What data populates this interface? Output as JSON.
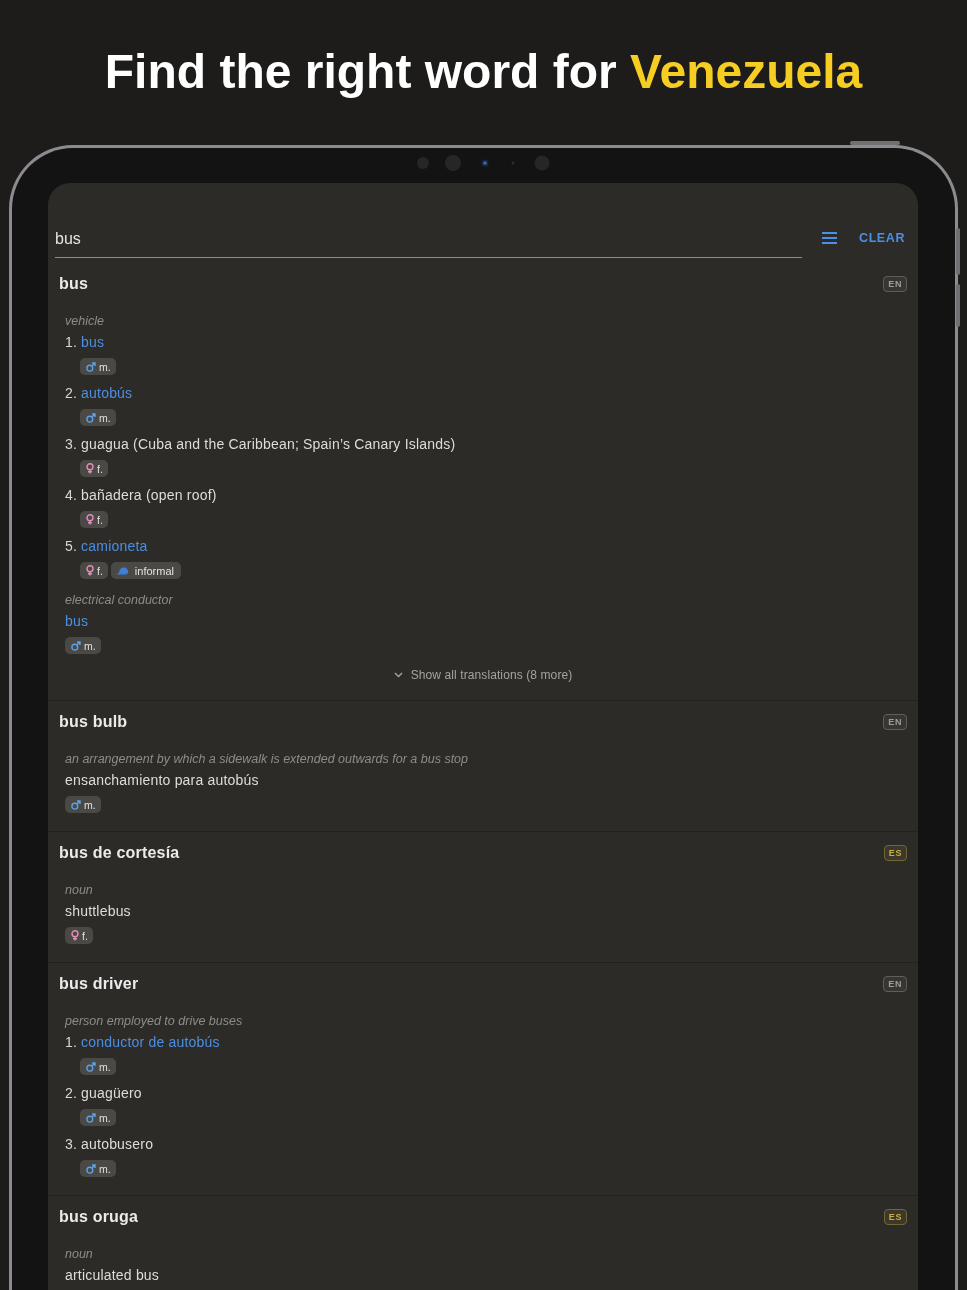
{
  "headline": {
    "text": "Find the right word for",
    "highlight": "Venezuela"
  },
  "search": {
    "value": "bus"
  },
  "clear_button": "CLEAR",
  "entries": [
    {
      "headword": "bus",
      "badge": {
        "text": "EN",
        "color": "#9d9c99"
      },
      "senses": [
        {
          "label": "vehicle",
          "translations": [
            {
              "number": "1.",
              "text": "bus",
              "linked": true,
              "tags": [
                {
                  "kind": "masculine",
                  "text": "m."
                }
              ]
            },
            {
              "number": "2.",
              "text": "autobús",
              "linked": true,
              "tags": [
                {
                  "kind": "masculine",
                  "text": "m."
                }
              ]
            },
            {
              "number": "3.",
              "text": "guagua (Cuba and the Caribbean; Spain’s Canary Islands)",
              "linked": false,
              "tags": [
                {
                  "kind": "feminine",
                  "text": "f."
                }
              ]
            },
            {
              "number": "4.",
              "text": "bañadera (open roof)",
              "linked": false,
              "tags": [
                {
                  "kind": "feminine",
                  "text": "f."
                }
              ]
            },
            {
              "number": "5.",
              "text": "camioneta",
              "linked": true,
              "tags": [
                {
                  "kind": "feminine",
                  "text": "f."
                },
                {
                  "kind": "register",
                  "text": "informal"
                }
              ]
            }
          ]
        },
        {
          "label": "electrical conductor",
          "translations": [
            {
              "text": "bus",
              "linked": true,
              "tags": [
                {
                  "kind": "masculine",
                  "text": "m."
                }
              ]
            }
          ]
        }
      ],
      "show_more": "Show all translations (8 more)"
    },
    {
      "headword": "bus bulb",
      "badge": {
        "text": "EN",
        "color": "#9d9c99"
      },
      "senses": [
        {
          "label": "an arrangement by which a sidewalk is extended outwards for a bus stop",
          "translations": [
            {
              "text": "ensanchamiento para autobús",
              "linked": false,
              "tags": [
                {
                  "kind": "masculine",
                  "text": "m."
                }
              ]
            }
          ]
        }
      ]
    },
    {
      "headword": "bus de cortesía",
      "badge": {
        "text": "ES",
        "color": "#c9ad45"
      },
      "senses": [
        {
          "label": "noun",
          "translations": [
            {
              "text": "shuttlebus",
              "linked": false,
              "tags": [
                {
                  "kind": "feminine",
                  "text": "f."
                }
              ]
            }
          ]
        }
      ]
    },
    {
      "headword": "bus driver",
      "badge": {
        "text": "EN",
        "color": "#9d9c99"
      },
      "senses": [
        {
          "label": "person employed to drive buses",
          "translations": [
            {
              "number": "1.",
              "text": "conductor de autobús",
              "linked": true,
              "tags": [
                {
                  "kind": "masculine",
                  "text": "m."
                }
              ]
            },
            {
              "number": "2.",
              "text": "guagüero",
              "linked": false,
              "tags": [
                {
                  "kind": "masculine",
                  "text": "m."
                }
              ]
            },
            {
              "number": "3.",
              "text": "autobusero",
              "linked": false,
              "tags": [
                {
                  "kind": "masculine",
                  "text": "m."
                }
              ]
            }
          ]
        }
      ]
    },
    {
      "headword": "bus oruga",
      "badge": {
        "text": "ES",
        "color": "#c9ad45"
      },
      "senses": [
        {
          "label": "noun",
          "translations": [
            {
              "text": "articulated bus",
              "linked": false
            }
          ]
        }
      ]
    }
  ]
}
